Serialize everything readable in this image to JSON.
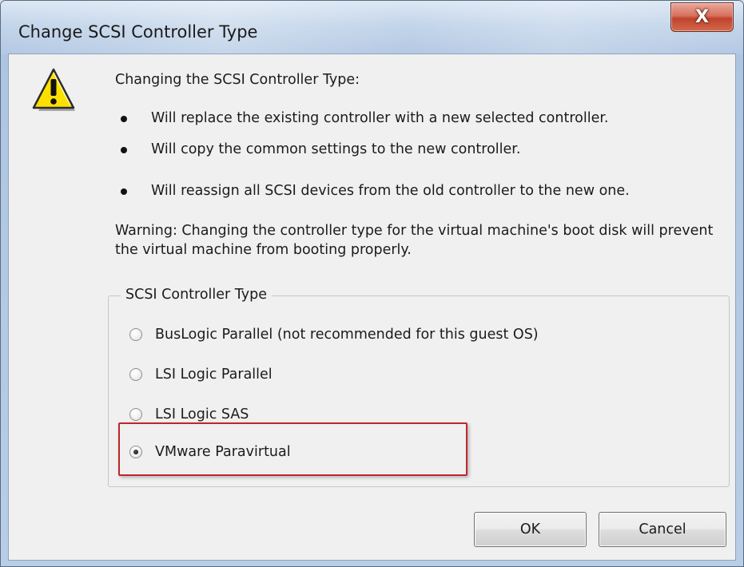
{
  "window": {
    "title": "Change SCSI Controller Type",
    "close_glyph": "X"
  },
  "icons": {
    "warning": "warning-triangle-icon"
  },
  "content": {
    "intro": "Changing the SCSI Controller Type:",
    "bullets": [
      "Will replace the existing controller with a new selected controller.",
      "Will copy the common settings to the new controller.",
      "Will reassign all SCSI devices from the old controller to the new one."
    ],
    "warning": "Warning: Changing the controller type for the virtual machine's boot disk will prevent the virtual machine from booting properly."
  },
  "group": {
    "legend": "SCSI Controller Type",
    "options": [
      {
        "label": "BusLogic Parallel (not recommended for this guest OS)",
        "checked": false
      },
      {
        "label": "LSI Logic Parallel",
        "checked": false
      },
      {
        "label": "LSI Logic SAS",
        "checked": false
      },
      {
        "label": "VMware Paravirtual",
        "checked": true
      }
    ]
  },
  "buttons": {
    "ok": "OK",
    "cancel": "Cancel"
  },
  "colors": {
    "highlight": "#c0262c",
    "close_button": "#c7472f",
    "warning_icon": "#fde000"
  }
}
